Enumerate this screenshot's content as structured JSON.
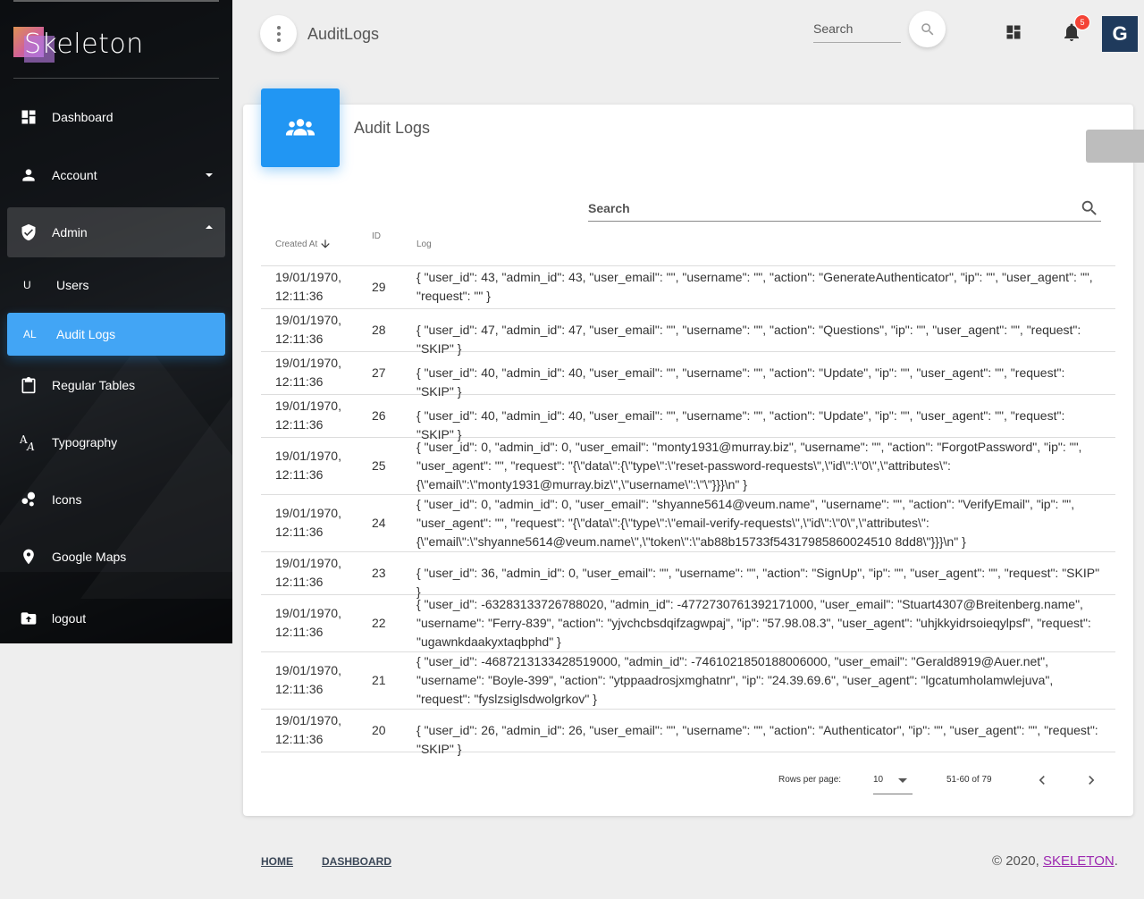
{
  "sidebar": {
    "logo_text": "Skeleton",
    "items": [
      {
        "name": "nav-dashboard",
        "icon": "dashboard-icon",
        "label": "Dashboard"
      },
      {
        "name": "nav-account",
        "icon": "person-icon",
        "label": "Account"
      },
      {
        "name": "nav-admin",
        "icon": "shield-check-icon",
        "label": "Admin"
      },
      {
        "name": "nav-users",
        "mini": "U",
        "label": "Users"
      },
      {
        "name": "nav-audit-logs",
        "mini": "AL",
        "label": "Audit Logs"
      },
      {
        "name": "nav-regular-tables",
        "icon": "clipboard-icon",
        "label": "Regular Tables"
      },
      {
        "name": "nav-typography",
        "icon": "typography-icon",
        "label": "Typography"
      },
      {
        "name": "nav-icons",
        "icon": "bubble-chart-icon",
        "label": "Icons"
      },
      {
        "name": "nav-google-maps",
        "icon": "location-pin-icon",
        "label": "Google Maps"
      },
      {
        "name": "nav-logout",
        "icon": "logout-icon",
        "label": "logout"
      }
    ]
  },
  "header": {
    "title": "AuditLogs",
    "search_placeholder": "Search",
    "notification_count": "5",
    "avatar_initial": "G"
  },
  "card": {
    "title": "Audit Logs",
    "search_placeholder": "Search",
    "columns": {
      "created": "Created At",
      "id": "ID",
      "log": "Log"
    },
    "rows": [
      {
        "date": "19/01/1970, 12:11:36",
        "id": "29",
        "log": "{ \"user_id\": 43, \"admin_id\": 43, \"user_email\": \"\", \"username\": \"\", \"action\": \"GenerateAuthenticator\", \"ip\": \"\", \"user_agent\": \"\", \"request\": \"\" }"
      },
      {
        "date": "19/01/1970, 12:11:36",
        "id": "28",
        "log": "{ \"user_id\": 47, \"admin_id\": 47, \"user_email\": \"\", \"username\": \"\", \"action\": \"Questions\", \"ip\": \"\", \"user_agent\": \"\", \"request\": \"SKIP\" }"
      },
      {
        "date": "19/01/1970, 12:11:36",
        "id": "27",
        "log": "{ \"user_id\": 40, \"admin_id\": 40, \"user_email\": \"\", \"username\": \"\", \"action\": \"Update\", \"ip\": \"\", \"user_agent\": \"\", \"request\": \"SKIP\" }"
      },
      {
        "date": "19/01/1970, 12:11:36",
        "id": "26",
        "log": "{ \"user_id\": 40, \"admin_id\": 40, \"user_email\": \"\", \"username\": \"\", \"action\": \"Update\", \"ip\": \"\", \"user_agent\": \"\", \"request\": \"SKIP\" }"
      },
      {
        "date": "19/01/1970, 12:11:36",
        "id": "25",
        "log": "{ \"user_id\": 0, \"admin_id\": 0, \"user_email\": \"monty1931@murray.biz\", \"username\": \"\", \"action\": \"ForgotPassword\", \"ip\": \"\", \"user_agent\": \"\", \"request\": \"{\\\"data\\\":{\\\"type\\\":\\\"reset-password-requests\\\",\\\"id\\\":\\\"0\\\",\\\"attributes\\\":{\\\"email\\\":\\\"monty1931@murray.biz\\\",\\\"username\\\":\\\"\\\"}}}\\n\" }"
      },
      {
        "date": "19/01/1970, 12:11:36",
        "id": "24",
        "log": "{ \"user_id\": 0, \"admin_id\": 0, \"user_email\": \"shyanne5614@veum.name\", \"username\": \"\", \"action\": \"VerifyEmail\", \"ip\": \"\", \"user_agent\": \"\", \"request\": \"{\\\"data\\\":{\\\"type\\\":\\\"email-verify-requests\\\",\\\"id\\\":\\\"0\\\",\\\"attributes\\\":{\\\"email\\\":\\\"shyanne5614@veum.name\\\",\\\"token\\\":\\\"ab88b15733f54317985860024510 8dd8\\\"}}}\\n\" }"
      },
      {
        "date": "19/01/1970, 12:11:36",
        "id": "23",
        "log": "{ \"user_id\": 36, \"admin_id\": 0, \"user_email\": \"\", \"username\": \"\", \"action\": \"SignUp\", \"ip\": \"\", \"user_agent\": \"\", \"request\": \"SKIP\" }"
      },
      {
        "date": "19/01/1970, 12:11:36",
        "id": "22",
        "log": "{ \"user_id\": -63283133726788020, \"admin_id\": -4772730761392171000, \"user_email\": \"Stuart4307@Breitenberg.name\", \"username\": \"Ferry-839\", \"action\": \"yjvchcbsdqifzagwpaj\", \"ip\": \"57.98.08.3\", \"user_agent\": \"uhjkkyidrsoieqylpsf\", \"request\": \"ugawnkdaakyxtaqbphd\" }"
      },
      {
        "date": "19/01/1970, 12:11:36",
        "id": "21",
        "log": "{ \"user_id\": -4687213133428519000, \"admin_id\": -7461021850188006000, \"user_email\": \"Gerald8919@Auer.net\", \"username\": \"Boyle-399\", \"action\": \"ytppaadrosjxmghatnr\", \"ip\": \"24.39.69.6\", \"user_agent\": \"lgcatumholamwlejuva\", \"request\": \"fyslzsiglsdwolgrkov\" }"
      },
      {
        "date": "19/01/1970, 12:11:36",
        "id": "20",
        "log": "{ \"user_id\": 26, \"admin_id\": 26, \"user_email\": \"\", \"username\": \"\", \"action\": \"Authenticator\", \"ip\": \"\", \"user_agent\": \"\", \"request\": \"SKIP\" }"
      }
    ],
    "pagination": {
      "rows_per_page_label": "Rows per page:",
      "rows_per_page": "10",
      "range": "51-60 of 79"
    }
  },
  "footer": {
    "links": [
      "HOME",
      "DASHBOARD"
    ],
    "copyright": "© 2020, ",
    "brand_link": "SKELETON",
    "suffix": "."
  },
  "colors": {
    "primary": "#2196f3",
    "active_nav": "#42a5f5",
    "badge": "#f44336",
    "link": "#9c27b0"
  }
}
